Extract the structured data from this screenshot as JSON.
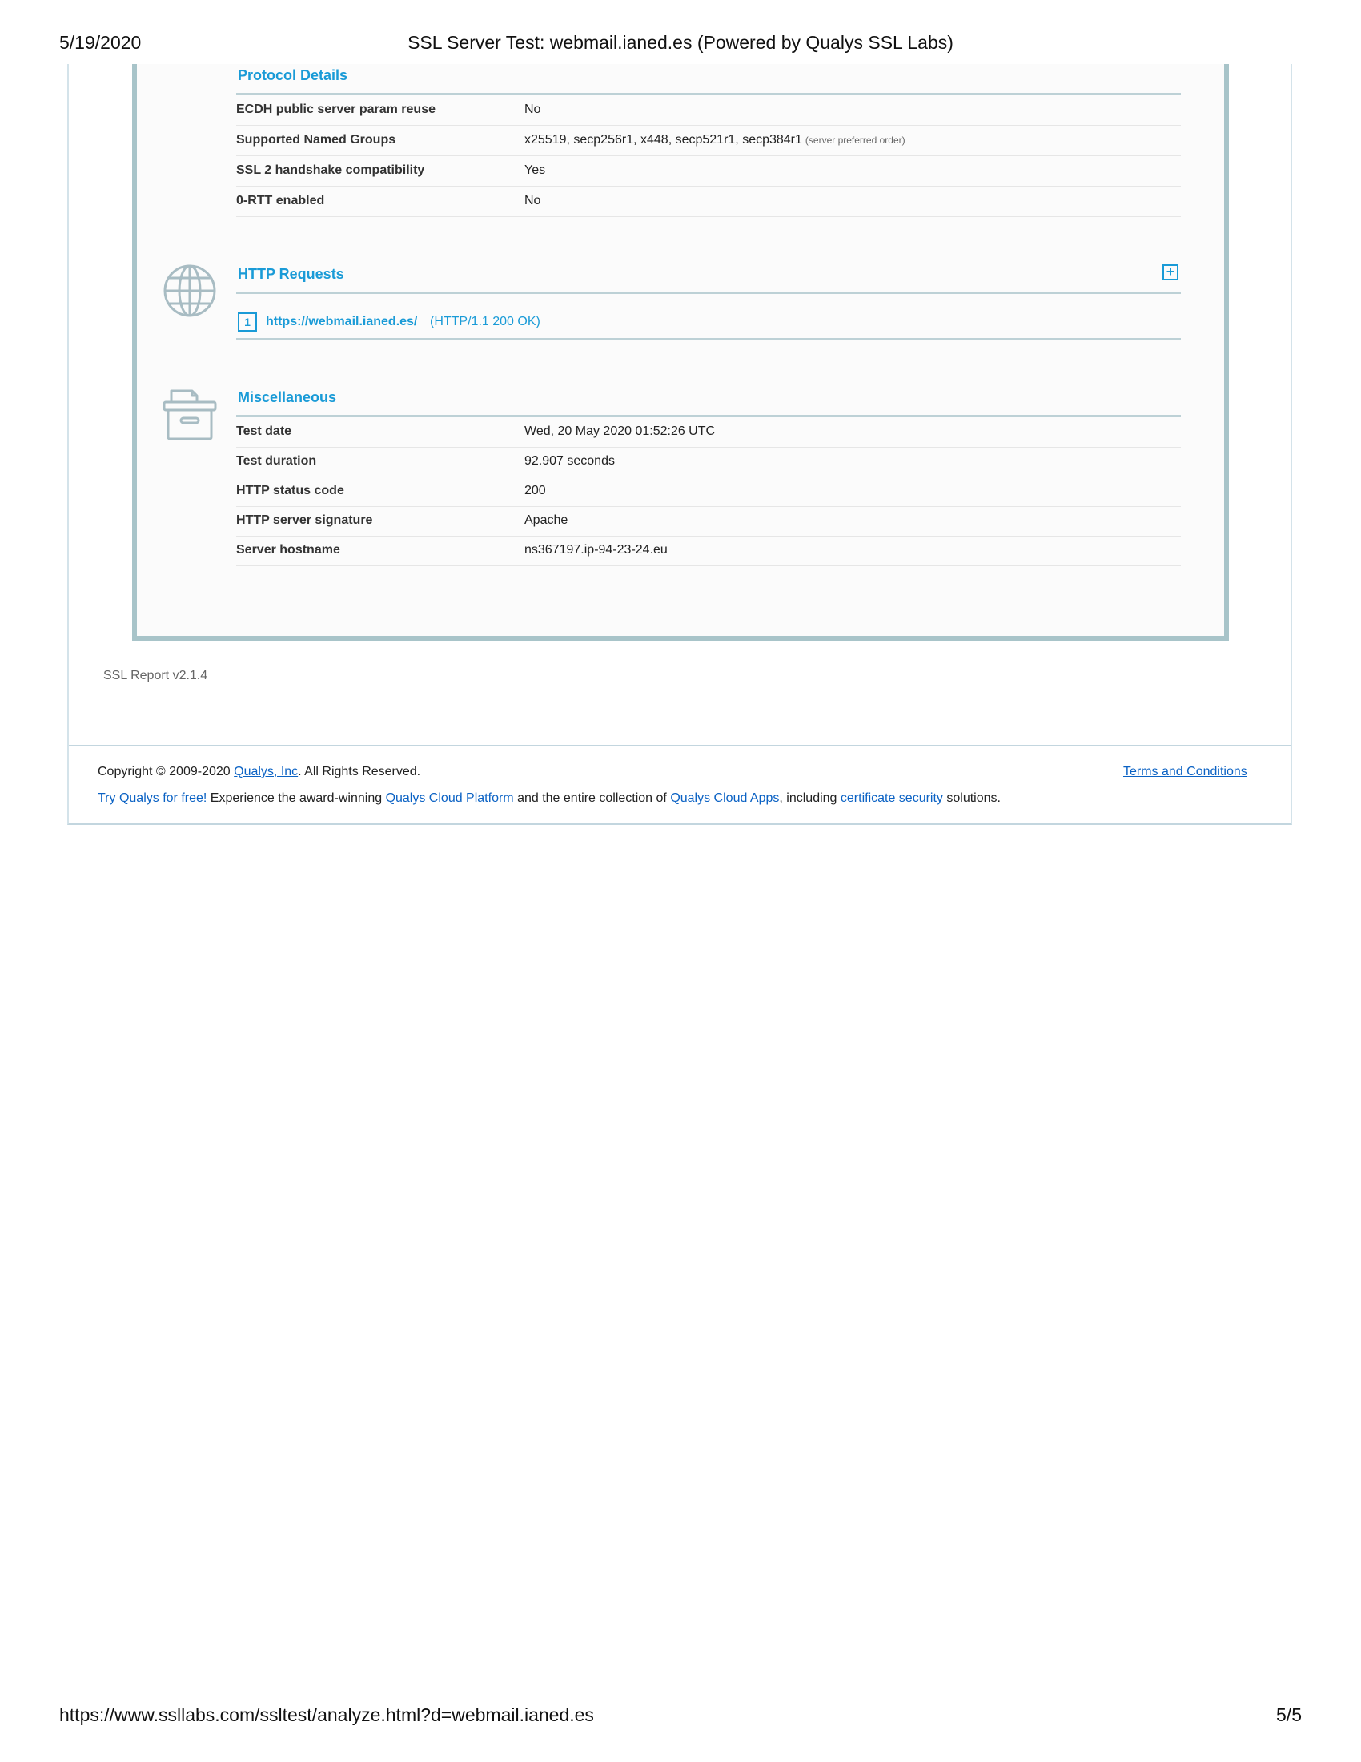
{
  "print_header": {
    "date": "5/19/2020",
    "title": "SSL Server Test: webmail.ianed.es (Powered by Qualys SSL Labs)"
  },
  "print_footer": {
    "url": "https://www.ssllabs.com/ssltest/analyze.html?d=webmail.ianed.es",
    "page": "5/5"
  },
  "protocol_details": {
    "title": "Protocol Details",
    "rows": [
      {
        "label": "ECDH public server param reuse",
        "value": "No",
        "note": ""
      },
      {
        "label": "Supported Named Groups",
        "value": "x25519, secp256r1, x448, secp521r1, secp384r1",
        "note": "(server preferred order)"
      },
      {
        "label": "SSL 2 handshake compatibility",
        "value": "Yes",
        "note": ""
      },
      {
        "label": "0-RTT enabled",
        "value": "No",
        "note": ""
      }
    ]
  },
  "http_requests": {
    "title": "HTTP Requests",
    "items": [
      {
        "number": "1",
        "url": "https://webmail.ianed.es/",
        "status": "(HTTP/1.1 200 OK)"
      }
    ]
  },
  "miscellaneous": {
    "title": "Miscellaneous",
    "rows": [
      {
        "label": "Test date",
        "value": "Wed, 20 May 2020 01:52:26 UTC"
      },
      {
        "label": "Test duration",
        "value": "92.907 seconds"
      },
      {
        "label": "HTTP status code",
        "value": "200"
      },
      {
        "label": "HTTP server signature",
        "value": "Apache"
      },
      {
        "label": "Server hostname",
        "value": "ns367197.ip-94-23-24.eu"
      }
    ]
  },
  "report_version": "SSL Report v2.1.4",
  "footer": {
    "copyright_prefix": "Copyright © 2009-2020 ",
    "company_link": "Qualys, Inc",
    "copyright_suffix": ". All Rights Reserved.",
    "terms_link": "Terms and Conditions",
    "promo": {
      "try_link": "Try Qualys for free!",
      "text1": " Experience the award-winning ",
      "platform_link": "Qualys Cloud Platform",
      "text2": " and the entire collection of ",
      "apps_link": "Qualys Cloud Apps",
      "text3": ", including ",
      "cert_link": "certificate security",
      "text4": " solutions."
    }
  },
  "colors": {
    "accent": "#1a9bd7",
    "frame": "#a8c4c9",
    "link": "#0b62c4"
  }
}
